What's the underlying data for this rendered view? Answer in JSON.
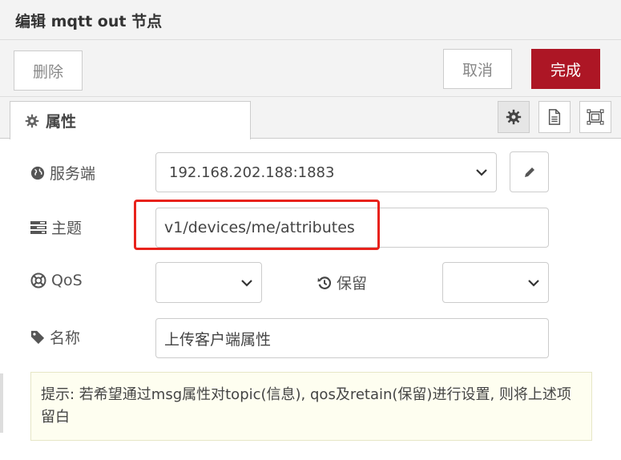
{
  "header": {
    "title": "编辑 mqtt out 节点"
  },
  "toolbar": {
    "delete_label": "删除",
    "cancel_label": "取消",
    "done_label": "完成"
  },
  "tabs": {
    "properties_label": "属性",
    "icons": [
      "gear-icon",
      "document-icon",
      "frame-icon"
    ]
  },
  "form": {
    "server": {
      "label": "服务端",
      "value": "192.168.202.188:1883",
      "icon": "globe-icon"
    },
    "topic": {
      "label": "主题",
      "value": "v1/devices/me/attributes",
      "icon": "tasks-icon"
    },
    "qos": {
      "label": "QoS",
      "value": "",
      "icon": "life-ring-icon"
    },
    "retain": {
      "label": "保留",
      "value": "",
      "icon": "history-icon"
    },
    "name": {
      "label": "名称",
      "value": "上传客户端属性",
      "icon": "tag-icon"
    }
  },
  "tip": {
    "text": "提示: 若希望通过msg属性对topic(信息), qos及retain(保留)进行设置, 则将上述项留白"
  },
  "colors": {
    "primary": "#ad1625",
    "highlight": "#e8221c",
    "tip_bg": "#fefef0"
  }
}
